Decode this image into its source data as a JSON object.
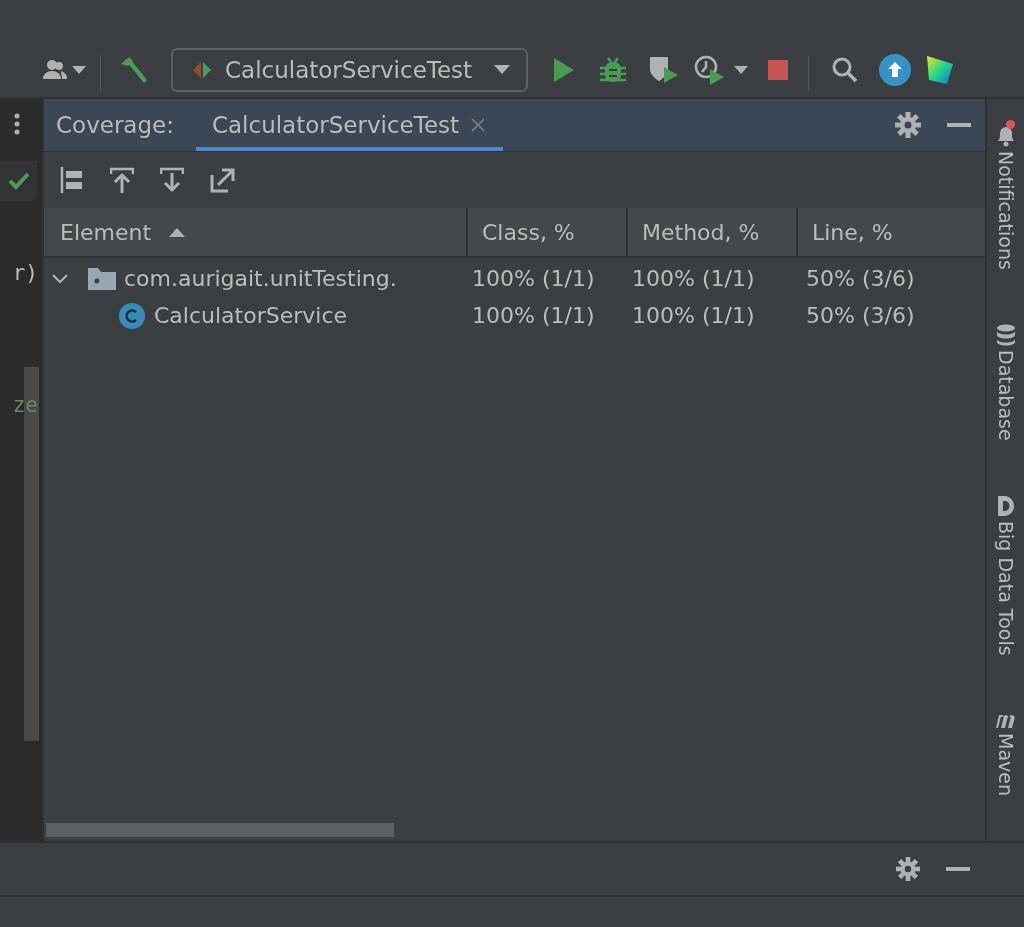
{
  "toolbar": {
    "run_config": "CalculatorServiceTest"
  },
  "editor": {
    "fragments": [
      "r)",
      "ze"
    ],
    "status_ok": true
  },
  "coverage_panel": {
    "title": "Coverage:",
    "tabs": [
      {
        "label": "CalculatorServiceTest",
        "selected": true
      }
    ],
    "table": {
      "columns": [
        {
          "label": "Element",
          "sorted": true
        },
        {
          "label": "Class, %",
          "sorted": false
        },
        {
          "label": "Method, %",
          "sorted": false
        },
        {
          "label": "Line, %",
          "sorted": false
        }
      ],
      "rows": [
        {
          "kind": "package",
          "name": "com.aurigait.unitTesting.",
          "expanded": true,
          "class": "100% (1/1)",
          "method": "100% (1/1)",
          "line": "50% (3/6)",
          "children": [
            {
              "kind": "class",
              "name": "CalculatorService",
              "class": "100% (1/1)",
              "method": "100% (1/1)",
              "line": "50% (3/6)"
            }
          ]
        }
      ]
    }
  },
  "right_sidebar": [
    {
      "kind": "notifications",
      "label": "Notifications",
      "badge": true
    },
    {
      "kind": "database",
      "label": "Database",
      "badge": false
    },
    {
      "kind": "bigdata",
      "label": "Big Data Tools",
      "badge": false
    },
    {
      "kind": "maven",
      "label": "Maven",
      "badge": false
    }
  ]
}
